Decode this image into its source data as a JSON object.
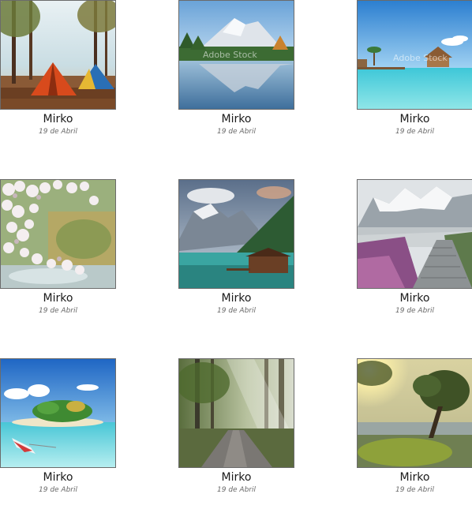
{
  "gallery": {
    "items": [
      {
        "name": "Mirko",
        "date": "19 de Abril",
        "image": "camping-tents-forest-image"
      },
      {
        "name": "Mirko",
        "date": "19 de Abril",
        "image": "mountain-lake-reflection-image"
      },
      {
        "name": "Mirko",
        "date": "19 de Abril",
        "image": "tropical-overwater-bungalow-image"
      },
      {
        "name": "Mirko",
        "date": "19 de Abril",
        "image": "cherry-blossom-stream-image"
      },
      {
        "name": "Mirko",
        "date": "19 de Abril",
        "image": "alpine-lake-boathouse-image"
      },
      {
        "name": "Mirko",
        "date": "19 de Abril",
        "image": "snowy-mountain-stone-path-image"
      },
      {
        "name": "Mirko",
        "date": "19 de Abril",
        "image": "tropical-island-boat-image"
      },
      {
        "name": "Mirko",
        "date": "19 de Abril",
        "image": "sunlit-forest-road-image"
      },
      {
        "name": "Mirko",
        "date": "19 de Abril",
        "image": "lakeside-tree-sunset-image"
      }
    ]
  },
  "watermark": "Adobe Stock"
}
